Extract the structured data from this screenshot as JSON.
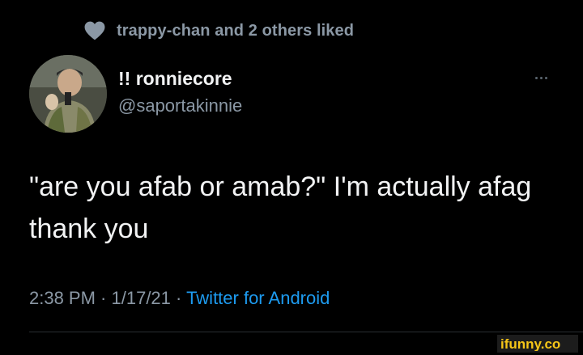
{
  "social_context": {
    "icon": "heart-icon",
    "text": "trappy-chan and 2 others liked"
  },
  "author": {
    "avatar": "avatar-photo",
    "display_name": "!! ronniecore",
    "handle": "@saportakinnie"
  },
  "more_icon": "more-dots-icon",
  "tweet": {
    "text": "\"are you afab or amab?\" I'm actually afag thank you"
  },
  "meta": {
    "time": "2:38 PM",
    "separator": " · ",
    "date": "1/17/21",
    "source": "Twitter for Android"
  },
  "watermark": {
    "text": "ifunny.co"
  },
  "colors": {
    "background": "#000000",
    "primary_text": "#f2f3f4",
    "secondary_text": "#8b98a5",
    "link": "#1d9bf0",
    "watermark": "#f5c518"
  }
}
